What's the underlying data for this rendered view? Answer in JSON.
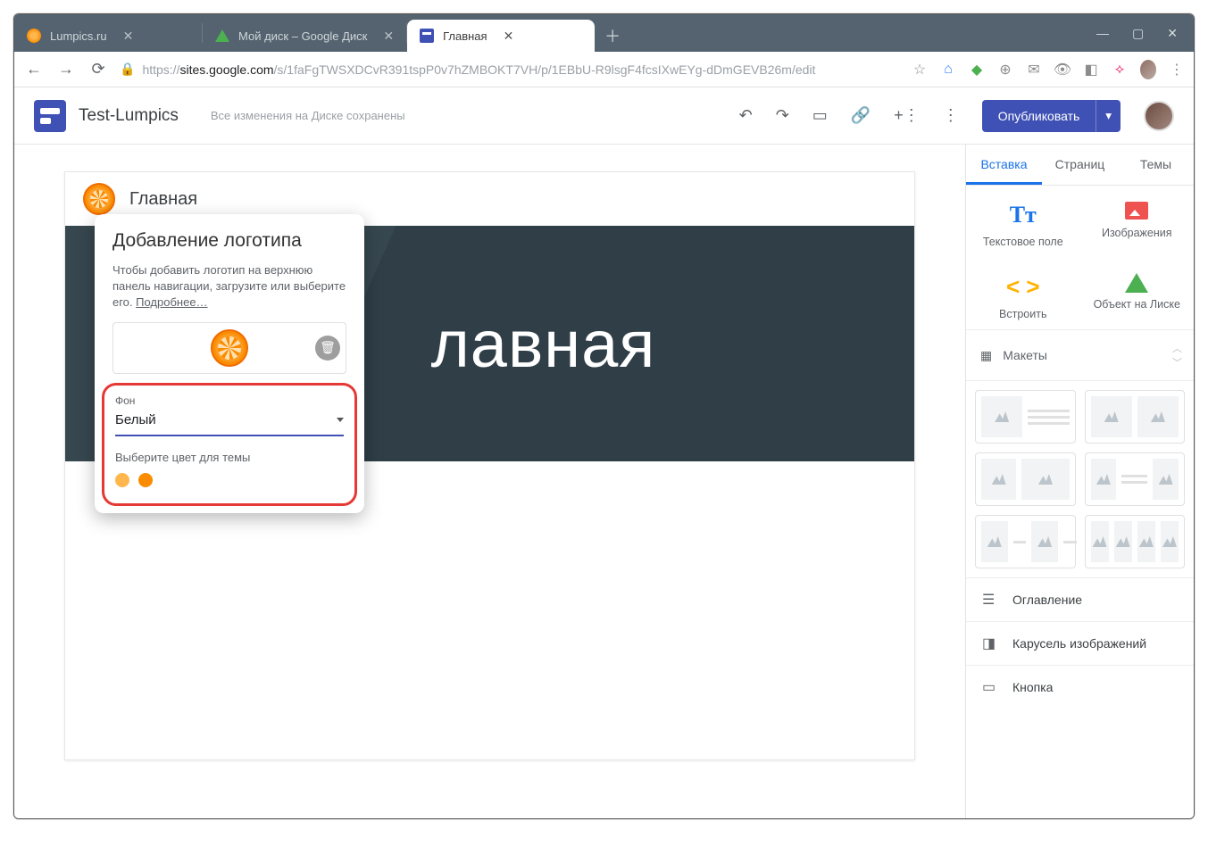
{
  "window": {
    "tabs": [
      {
        "label": "Lumpics.ru"
      },
      {
        "label": "Мой диск – Google Диск"
      },
      {
        "label": "Главная"
      }
    ]
  },
  "addressbar": {
    "protocol": "https://",
    "host": "sites.google.com",
    "path": "/s/1faFgTWSXDCvR391tspP0v7hZMBOKT7VH/p/1EBbU-R9lsgF4fcsIXwEYg-dDmGEVB26m/edit"
  },
  "app": {
    "doc_title": "Test-Lumpics",
    "save_status": "Все изменения на Диске сохранены",
    "publish_label": "Опубликовать"
  },
  "canvas": {
    "nav_title": "Главная",
    "hero_title": "лавная"
  },
  "popup": {
    "title": "Добавление логотипа",
    "desc_prefix": "Чтобы добавить логотип на верхнюю панель навигации, загрузите или выберите его. ",
    "desc_link": "Подробнее…",
    "bg_label": "Фон",
    "bg_value": "Белый",
    "theme_label": "Выберите цвет для темы"
  },
  "sidebar": {
    "tabs": {
      "insert": "Вставка",
      "pages": "Страниц",
      "themes": "Темы"
    },
    "insert": {
      "text": "Текстовое поле",
      "images": "Изображения",
      "embed": "Встроить",
      "drive": "Объект на Лиске"
    },
    "layouts_label": "Макеты",
    "items": {
      "toc": "Оглавление",
      "carousel": "Карусель изображений",
      "button": "Кнопка"
    }
  }
}
